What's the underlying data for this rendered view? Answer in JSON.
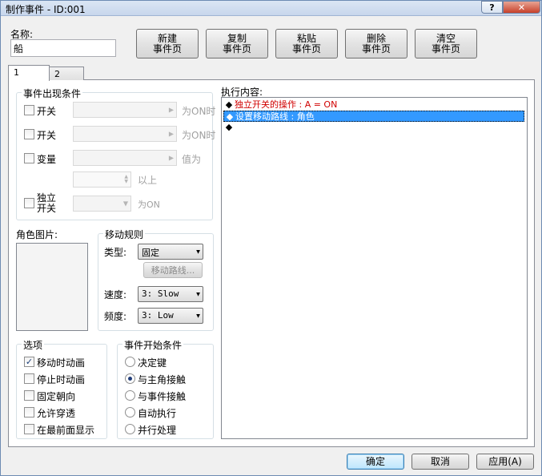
{
  "window": {
    "title": "制作事件 - ID:001",
    "help_glyph": "?",
    "close_glyph": "✕"
  },
  "name": {
    "label": "名称:",
    "value": "船"
  },
  "toolbar": {
    "new_label": "新建\n事件页",
    "copy_label": "复制\n事件页",
    "paste_label": "粘贴\n事件页",
    "delete_label": "删除\n事件页",
    "clear_label": "清空\n事件页"
  },
  "tabs": [
    {
      "label": "1"
    },
    {
      "label": "2"
    }
  ],
  "conditions": {
    "title": "事件出现条件",
    "switch1": {
      "label": "开关",
      "suffix": "为ON时"
    },
    "switch2": {
      "label": "开关",
      "suffix": "为ON时"
    },
    "variable": {
      "label": "变量",
      "suffix": "值为",
      "above": "以上"
    },
    "self_switch": {
      "label": "独立\n开关",
      "suffix": "为ON"
    }
  },
  "graphic": {
    "title": "角色图片:"
  },
  "movement": {
    "title": "移动规则",
    "type_label": "类型:",
    "type_value": "固定",
    "route_button": "移动路线...",
    "speed_label": "速度:",
    "speed_value": "3: Slow",
    "freq_label": "频度:",
    "freq_value": "3: Low"
  },
  "options": {
    "title": "选项",
    "items": [
      {
        "label": "移动时动画",
        "checked": true
      },
      {
        "label": "停止时动画",
        "checked": false
      },
      {
        "label": "固定朝向",
        "checked": false
      },
      {
        "label": "允许穿透",
        "checked": false
      },
      {
        "label": "在最前面显示",
        "checked": false
      }
    ]
  },
  "trigger": {
    "title": "事件开始条件",
    "items": [
      {
        "label": "决定键",
        "selected": false
      },
      {
        "label": "与主角接触",
        "selected": true
      },
      {
        "label": "与事件接触",
        "selected": false
      },
      {
        "label": "自动执行",
        "selected": false
      },
      {
        "label": "并行处理",
        "selected": false
      }
    ]
  },
  "commands": {
    "title": "执行内容:",
    "lines": [
      {
        "bullet": "◆",
        "text": "独立开关的操作 : A = ON",
        "color": "#d00000"
      },
      {
        "bullet": "◆",
        "text": "设置移动路线 : 角色",
        "color": "#ffffff"
      },
      {
        "bullet": "◆",
        "text": "",
        "color": "#000000"
      }
    ]
  },
  "footer": {
    "ok": "确定",
    "cancel": "取消",
    "apply": "应用(A)"
  },
  "colors": {
    "selection": "#3399ff",
    "accent_text": "#d00000"
  }
}
